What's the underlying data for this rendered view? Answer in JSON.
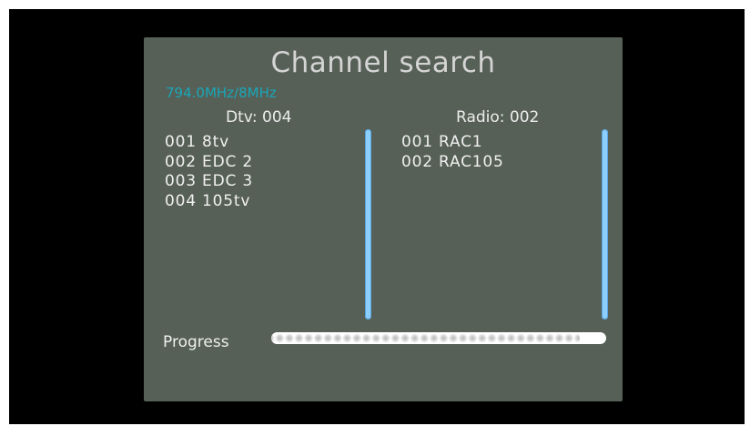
{
  "title": "Channel search",
  "frequency": "794.0MHz/8MHz",
  "dtv": {
    "header": "Dtv: 004",
    "channels": [
      "001 8tv",
      "002 EDC 2",
      "003 EDC 3",
      "004 105tv"
    ]
  },
  "radio": {
    "header": "Radio: 002",
    "channels": [
      "001 RAC1",
      "002 RAC105"
    ]
  },
  "progress": {
    "label": "Progress",
    "fraction": 0.92
  },
  "colors": {
    "panel_background": "#566056",
    "frequency_text": "#19a6b8",
    "scrollbar": "#8ccfff"
  }
}
